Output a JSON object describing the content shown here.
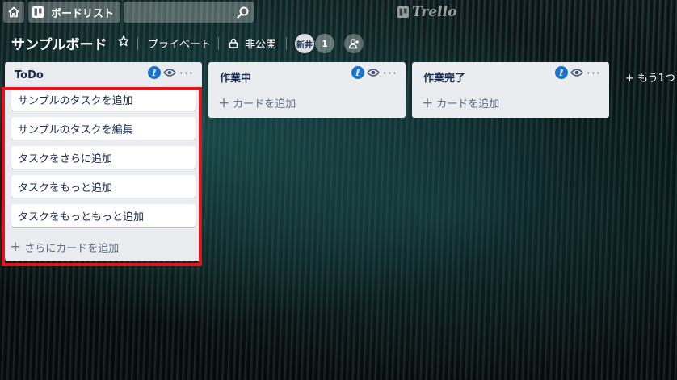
{
  "topbar": {
    "boards_label": "ボードリスト",
    "search_value": "",
    "logo_text": "Trello"
  },
  "board": {
    "title": "サンプルボード",
    "team_label": "プライベート",
    "visibility_label": "非公開",
    "member_avatar": "新井",
    "member_count": "1"
  },
  "lists": [
    {
      "title": "ToDo",
      "cards": [
        "サンプルのタスクを追加",
        "サンプルのタスクを編集",
        "タスクをさらに追加",
        "タスクをもっと追加",
        "タスクをもっともっと追加"
      ],
      "add_label": "さらにカードを追加"
    },
    {
      "title": "作業中",
      "cards": [],
      "add_label": "カードを追加"
    },
    {
      "title": "作業完了",
      "cards": [],
      "add_label": "カードを追加"
    }
  ],
  "add_list_label": "+ もう1つ"
}
